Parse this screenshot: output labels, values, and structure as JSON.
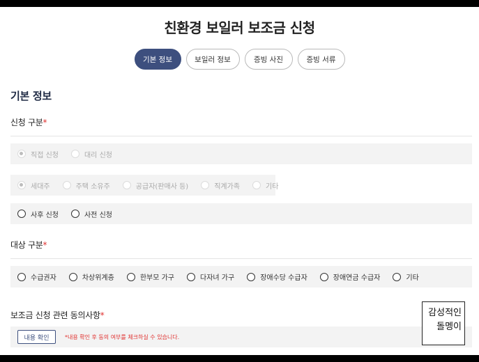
{
  "title": "친환경 보일러 보조금 신청",
  "tabs": [
    "기본 정보",
    "보일러 정보",
    "증빙 사진",
    "증빙 서류"
  ],
  "section_basic": "기본 정보",
  "apply_type": {
    "label": "신청 구분",
    "required_mark": "*",
    "row1": [
      "직접 신청",
      "대리 신청"
    ],
    "row2": [
      "세대주",
      "주택 소유주",
      "공급자(판매사 등)",
      "직계가족",
      "기타"
    ],
    "row3": [
      "사후 신청",
      "사전 신청"
    ]
  },
  "target_type": {
    "label": "대상 구분",
    "required_mark": "*",
    "options": [
      "수급권자",
      "차상위계층",
      "한부모 가구",
      "다자녀 가구",
      "장애수당 수급자",
      "장애연금 수급자",
      "기타"
    ]
  },
  "consent": {
    "label": "보조금 신청 관련 동의사항",
    "required_mark": "*",
    "button": "내용 확인",
    "notice": "*내용 확인 후 동의 여부를 체크하실 수 있습니다."
  },
  "watermark": [
    "감성적인",
    "돌멩이"
  ],
  "colors": {
    "accent": "#3d4f7e",
    "required": "#e0312f",
    "group_bg": "#f3f3f3"
  }
}
